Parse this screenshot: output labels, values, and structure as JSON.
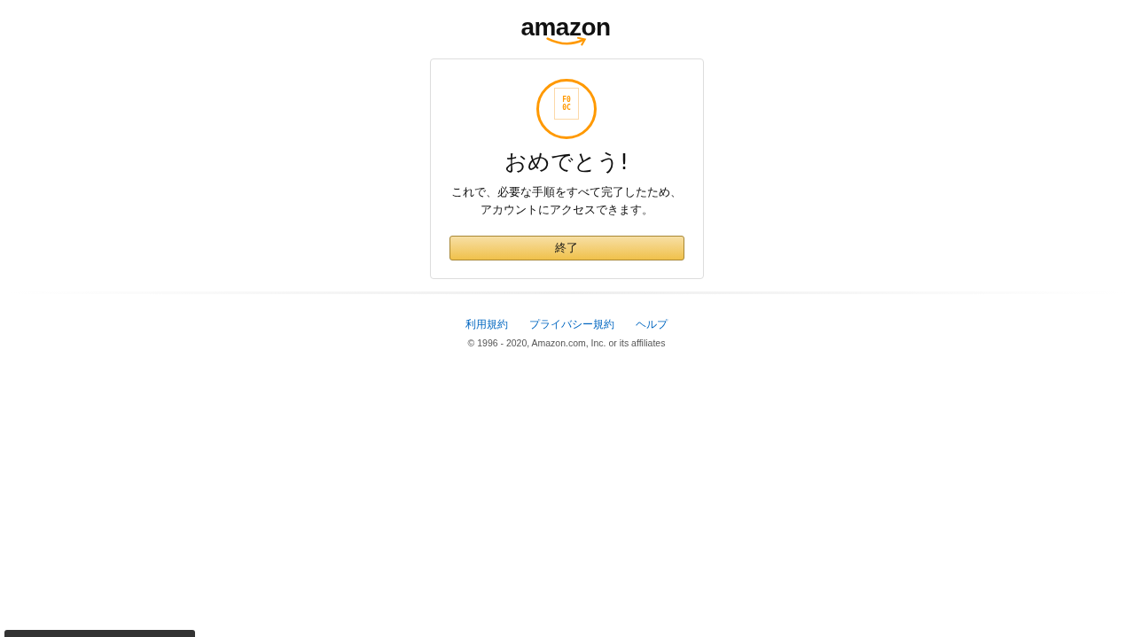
{
  "logo": {
    "text": "amazon"
  },
  "card": {
    "icon_glyph": [
      "F0",
      "0C"
    ],
    "title": "おめでとう!",
    "message_lines": [
      "これで、必要な手順をすべて完了したため、",
      "アカウントにアクセスできます。"
    ],
    "button": "終了"
  },
  "footer": {
    "links": [
      "利用規約",
      "プライバシー規約",
      "ヘルプ"
    ],
    "copyright": "© 1996 - 2020, Amazon.com, Inc. or its affiliates"
  }
}
